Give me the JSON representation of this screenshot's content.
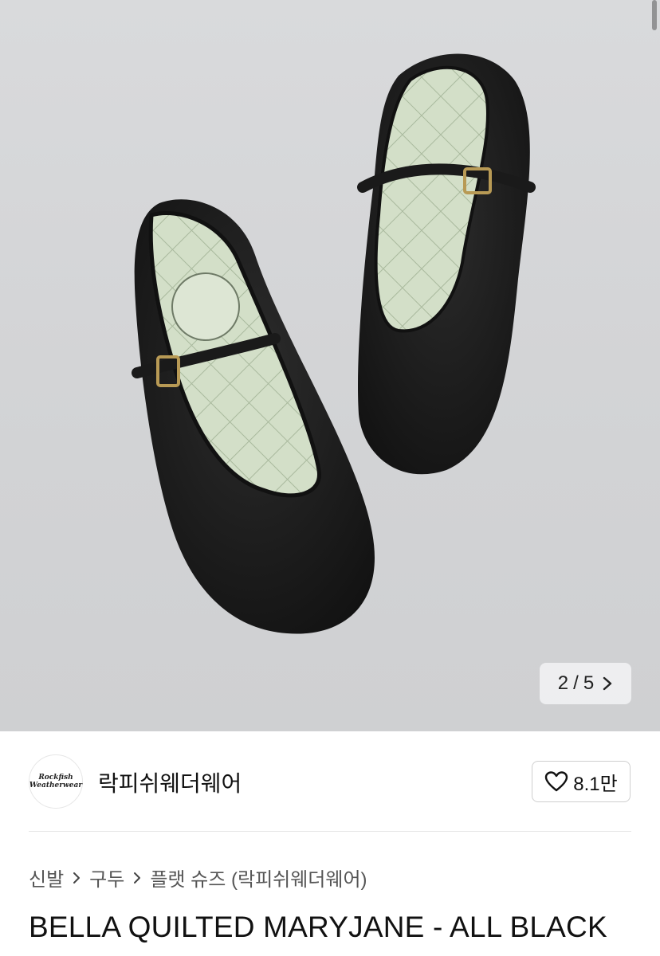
{
  "gallery": {
    "current": "2",
    "divider": "/",
    "total": "5",
    "next_icon": "chevron-right-icon"
  },
  "store": {
    "name": "락피쉬웨더웨어",
    "logo_text_line1": "Rockfish",
    "logo_text_line2": "Weatherwear",
    "like_count": "8.1만",
    "like_icon": "heart-outline-icon"
  },
  "breadcrumb": {
    "items": [
      "신발",
      "구두",
      "플랫 슈즈 (락피쉬웨더웨어)"
    ],
    "separator_icon": "chevron-right-icon"
  },
  "product": {
    "title": "BELLA QUILTED MARYJANE - ALL BLACK"
  },
  "colors": {
    "photo_background": "#d4d5d7",
    "shoe_velvet": "#1d1d1d",
    "insole": "#cfdcc4"
  }
}
